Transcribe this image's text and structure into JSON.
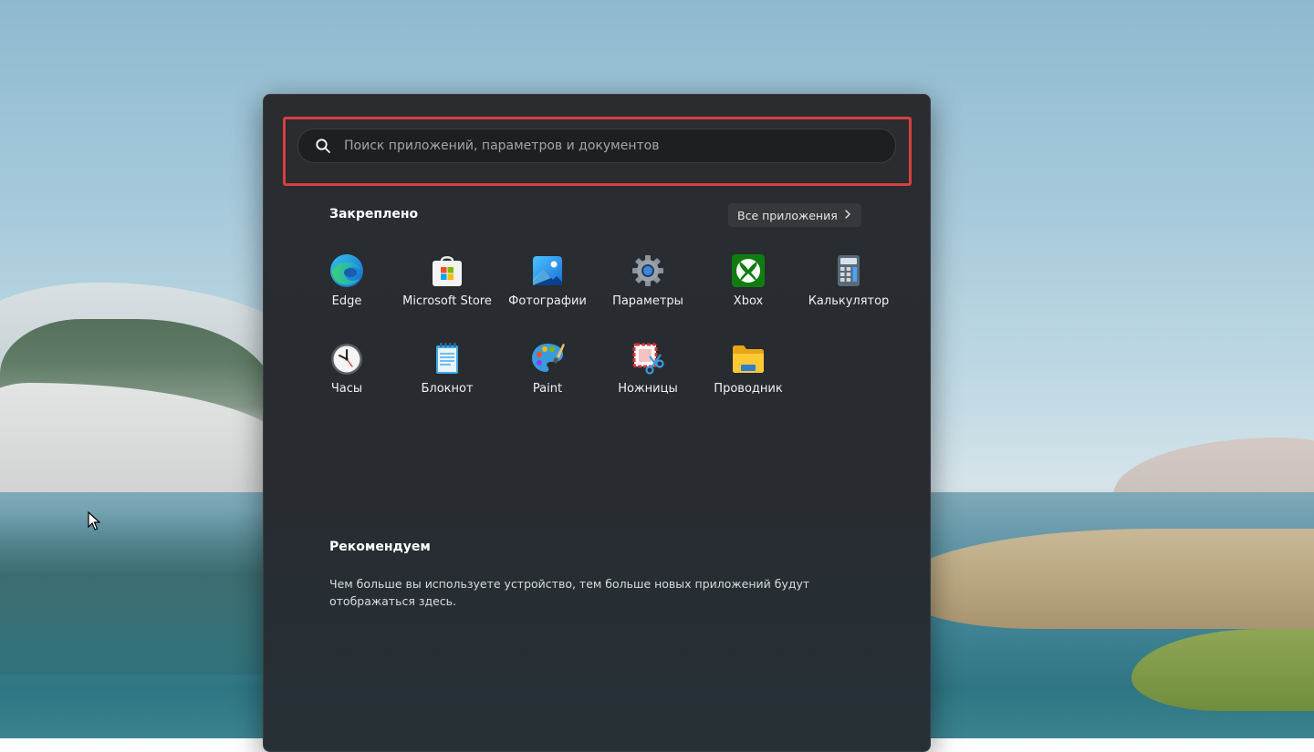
{
  "search": {
    "placeholder": "Поиск приложений, параметров и документов"
  },
  "pinned": {
    "title": "Закреплено",
    "all_apps_label": "Все приложения",
    "apps": [
      {
        "label": "Edge",
        "icon": "edge-icon"
      },
      {
        "label": "Microsoft Store",
        "icon": "microsoft-store-icon"
      },
      {
        "label": "Фотографии",
        "icon": "photos-icon"
      },
      {
        "label": "Параметры",
        "icon": "settings-gear-icon"
      },
      {
        "label": "Xbox",
        "icon": "xbox-icon"
      },
      {
        "label": "Калькулятор",
        "icon": "calculator-icon"
      },
      {
        "label": "Часы",
        "icon": "clock-icon"
      },
      {
        "label": "Блокнот",
        "icon": "notepad-icon"
      },
      {
        "label": "Paint",
        "icon": "paint-palette-icon"
      },
      {
        "label": "Ножницы",
        "icon": "snipping-tool-icon"
      },
      {
        "label": "Проводник",
        "icon": "file-explorer-folder-icon"
      }
    ]
  },
  "recommended": {
    "title": "Рекомендуем",
    "text": "Чем больше вы используете устройство, тем больше новых приложений будут отображаться здесь."
  },
  "colors": {
    "menu_bg": "#2a2c30",
    "highlight": "#d64040"
  }
}
